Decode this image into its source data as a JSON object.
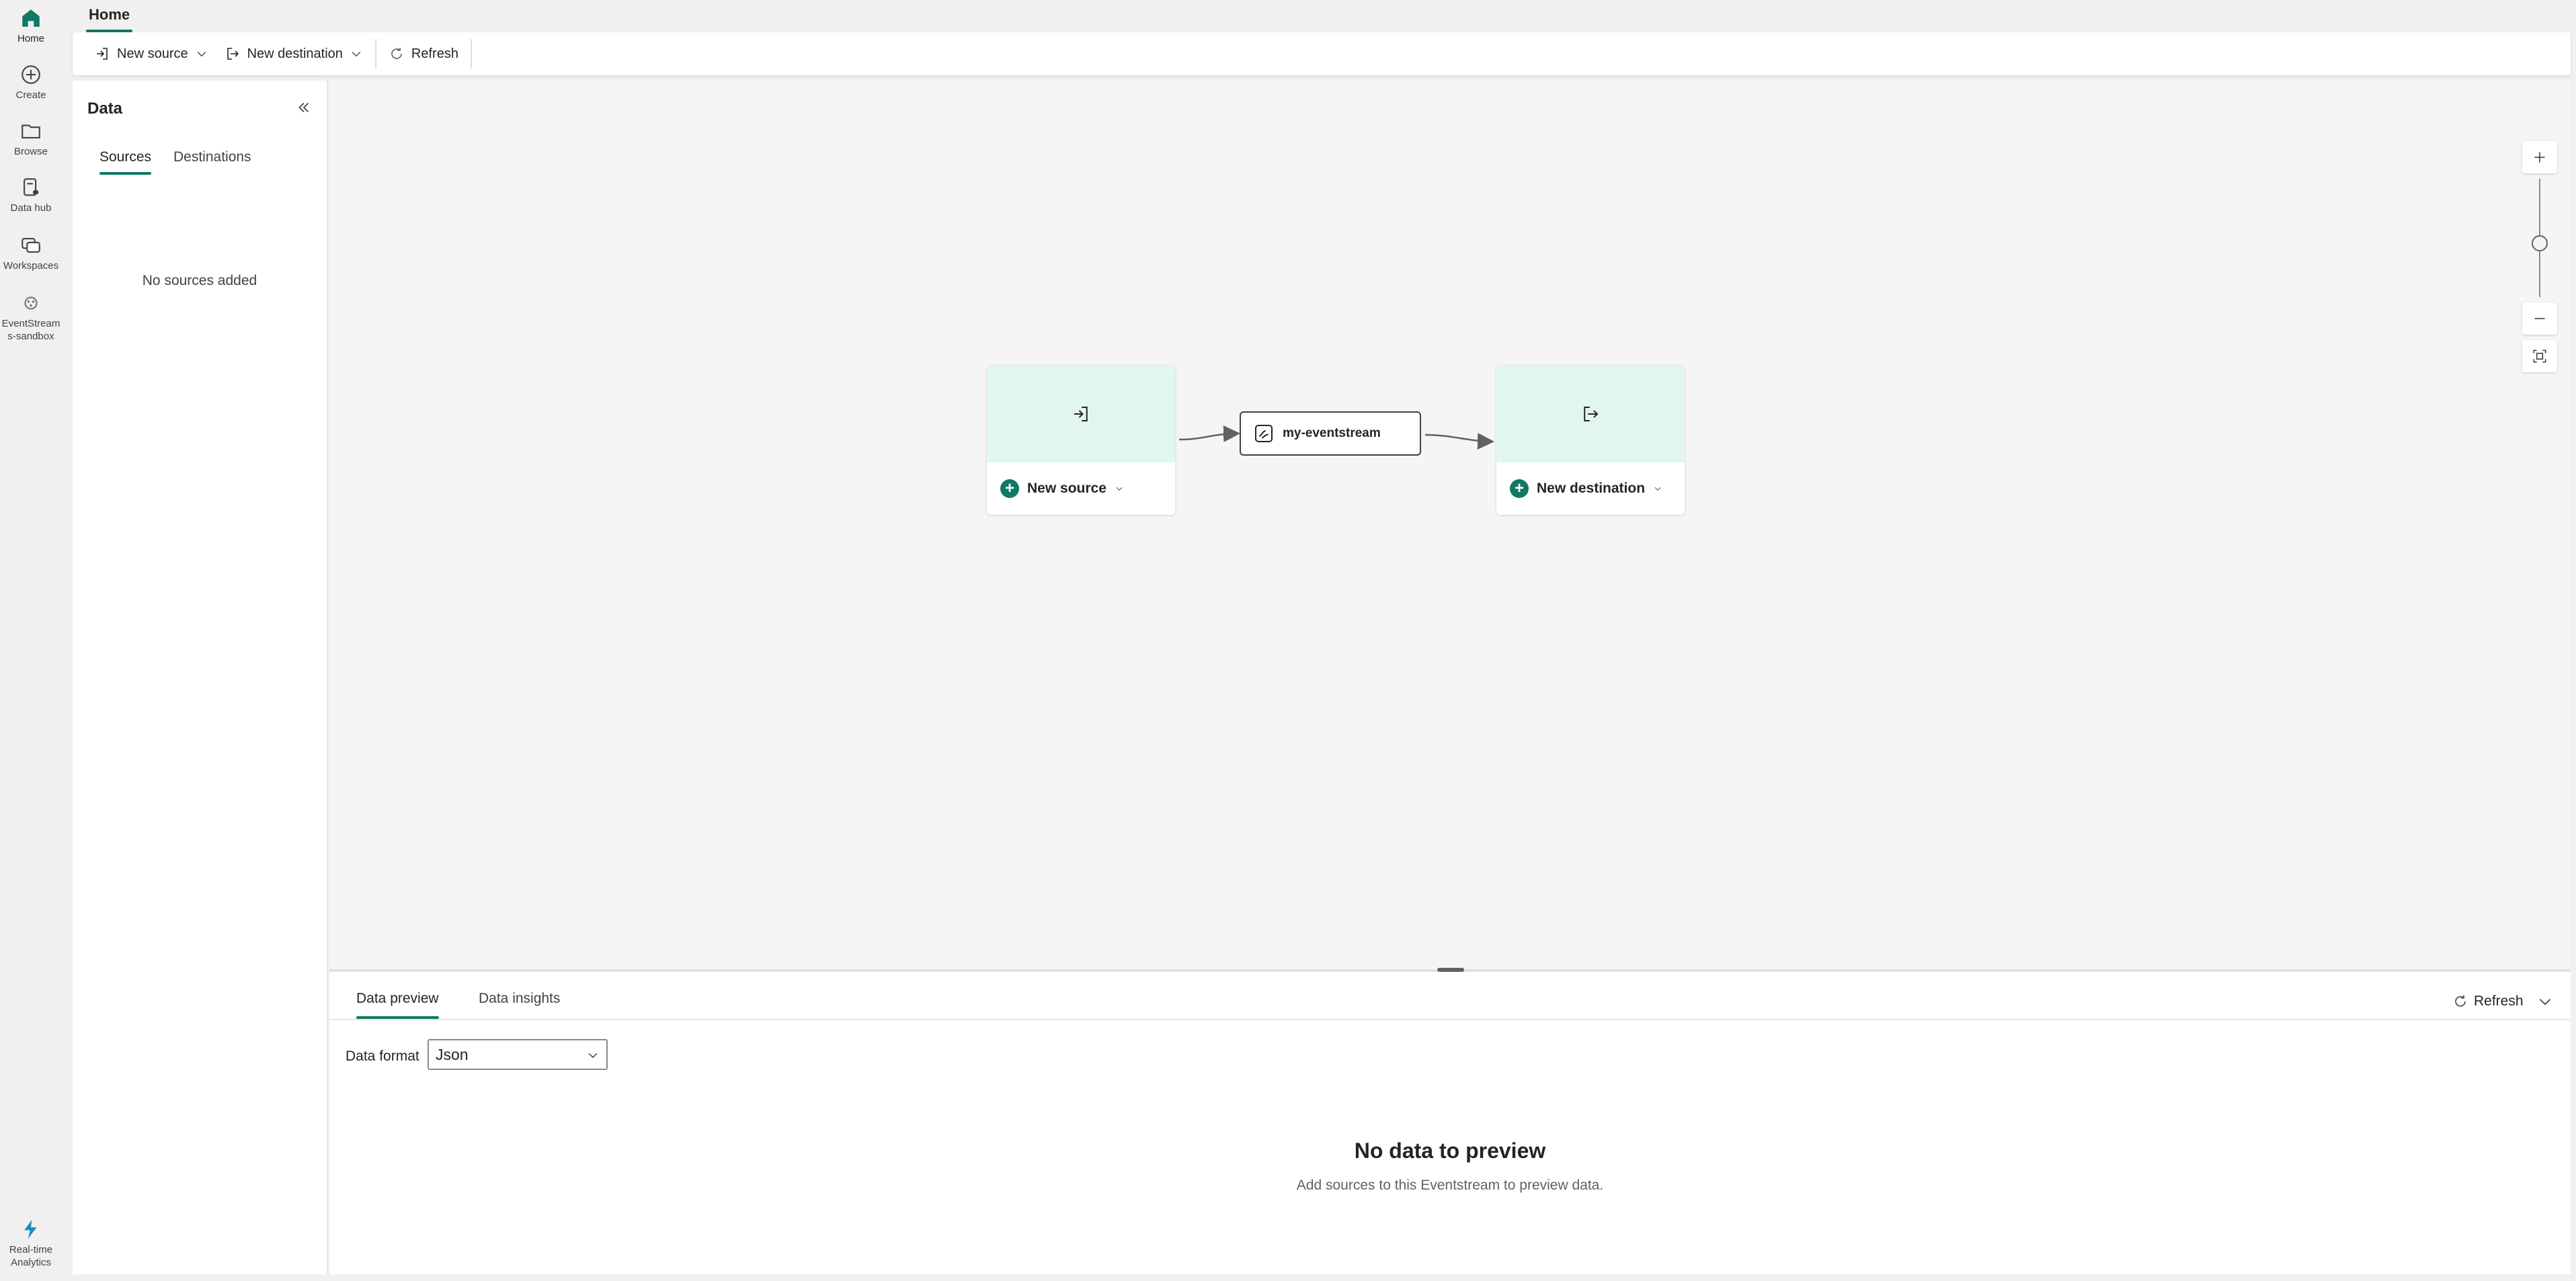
{
  "rail": {
    "home": "Home",
    "create": "Create",
    "browse": "Browse",
    "datahub": "Data hub",
    "workspaces": "Workspaces",
    "workspace_line1": "EventStream",
    "workspace_line2": "s-sandbox",
    "experience_line1": "Real-time",
    "experience_line2": "Analytics"
  },
  "tabs": {
    "home": "Home"
  },
  "ribbon": {
    "new_source": "New source",
    "new_destination": "New destination",
    "refresh": "Refresh"
  },
  "data_panel": {
    "title": "Data",
    "tabs": [
      "Sources",
      "Destinations"
    ],
    "empty": "No sources added"
  },
  "canvas": {
    "source_label": "New source",
    "stream_name": "my-eventstream",
    "destination_label": "New destination"
  },
  "preview": {
    "tabs": [
      "Data preview",
      "Data insights"
    ],
    "refresh": "Refresh",
    "format_label": "Data format",
    "format_value": "Json",
    "empty_title": "No data to preview",
    "empty_sub": "Add sources to this Eventstream to preview data."
  },
  "colors": {
    "accent": "#117865",
    "node_fill": "#e1f6ef"
  }
}
